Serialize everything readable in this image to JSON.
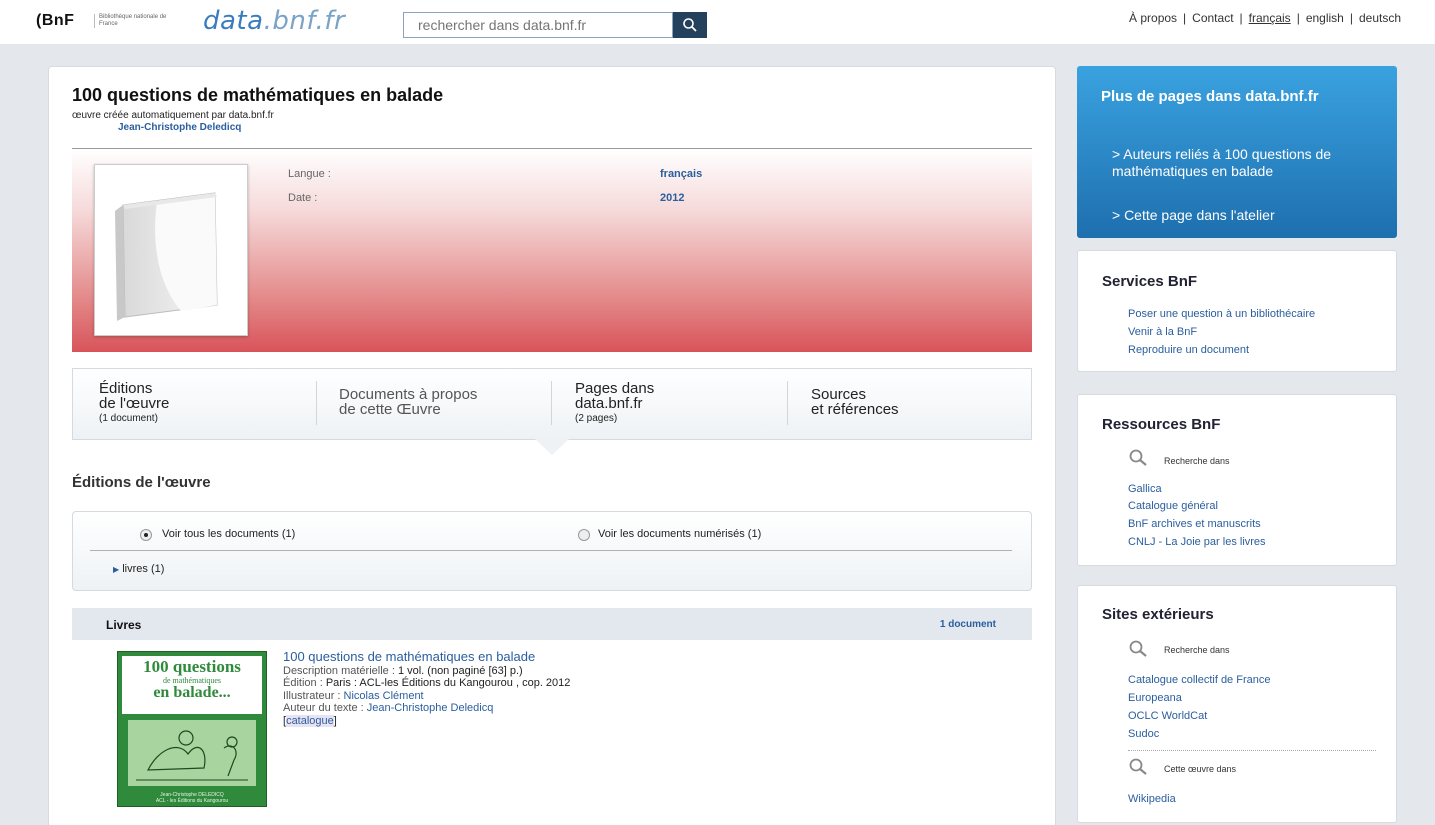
{
  "header": {
    "logo_bnf": "BnF",
    "logo_sub": "Bibliothèque nationale de France",
    "logo_data_a": "data",
    "logo_data_b": ".bnf.fr",
    "search_placeholder": "rechercher dans data.bnf.fr",
    "links": {
      "apropos": "À propos",
      "contact": "Contact",
      "francais": "français",
      "english": "english",
      "deutsch": "deutsch",
      "sep": "|"
    }
  },
  "work": {
    "title": "100 questions de mathématiques en balade",
    "subtitle": "œuvre créée automatiquement par data.bnf.fr",
    "author": "Jean-Christophe Deledicq",
    "langue_label": "Langue :",
    "langue_value": "français",
    "date_label": "Date :",
    "date_value": "2012"
  },
  "tabs": [
    {
      "line1": "Éditions",
      "line2": "de l'œuvre",
      "line3": "(1 document)"
    },
    {
      "line1": "Documents à propos",
      "line2": "de cette Œuvre",
      "line3": ""
    },
    {
      "line1": "Pages dans",
      "line2": "data.bnf.fr",
      "line3": "(2 pages)"
    },
    {
      "line1": "Sources",
      "line2": "et références",
      "line3": ""
    }
  ],
  "section_title": "Éditions de l'œuvre",
  "filters": {
    "all": "Voir tous les documents (1)",
    "digitized": "Voir les documents numérisés (1)",
    "livres": "livres (1)"
  },
  "livres": {
    "title": "Livres",
    "count": "1 document"
  },
  "cover": {
    "l1": "100 questions",
    "l2": "de mathématiques",
    "l3": "en balade...",
    "author": "Jean-Christophe DELEDICQ",
    "publisher": "ACL - les Éditions du Kangourou"
  },
  "document": {
    "title": "100 questions de mathématiques en balade",
    "desc_label": "Description matérielle : ",
    "desc_value": "1 vol. (non paginé [63] p.)",
    "edition_label": "Édition : ",
    "edition_value": "Paris : ACL-les Éditions du Kangourou , cop. 2012",
    "illus_label": "Illustrateur : ",
    "illus_value": "Nicolas Clément",
    "auteur_label": "Auteur du texte : ",
    "auteur_value": "Jean-Christophe Deledicq",
    "catalogue": "catalogue"
  },
  "sidebar": {
    "more_title": "Plus de pages dans data.bnf.fr",
    "more_items": [
      "> Auteurs reliés à 100 questions de mathématiques en balade",
      "> Cette page dans l'atelier"
    ],
    "services_title": "Services BnF",
    "services": [
      "Poser une question à un bibliothécaire",
      "Venir à la BnF",
      "Reproduire un document"
    ],
    "resources_title": "Ressources BnF",
    "resources_search": "Recherche dans",
    "resources": [
      "Gallica",
      "Catalogue général",
      "BnF archives et manuscrits",
      "CNLJ - La Joie par les livres"
    ],
    "external_title": "Sites extérieurs",
    "external_search": "Recherche dans",
    "external": [
      "Catalogue collectif de France",
      "Europeana",
      "OCLC WorldCat",
      "Sudoc"
    ],
    "oeuvre_search": "Cette œuvre dans",
    "oeuvre_links": [
      "Wikipedia"
    ]
  },
  "colors": {
    "accent_blue": "#2a5e9e",
    "sidebar_blue": "#1e6fae",
    "banner_red": "#d8545a"
  }
}
